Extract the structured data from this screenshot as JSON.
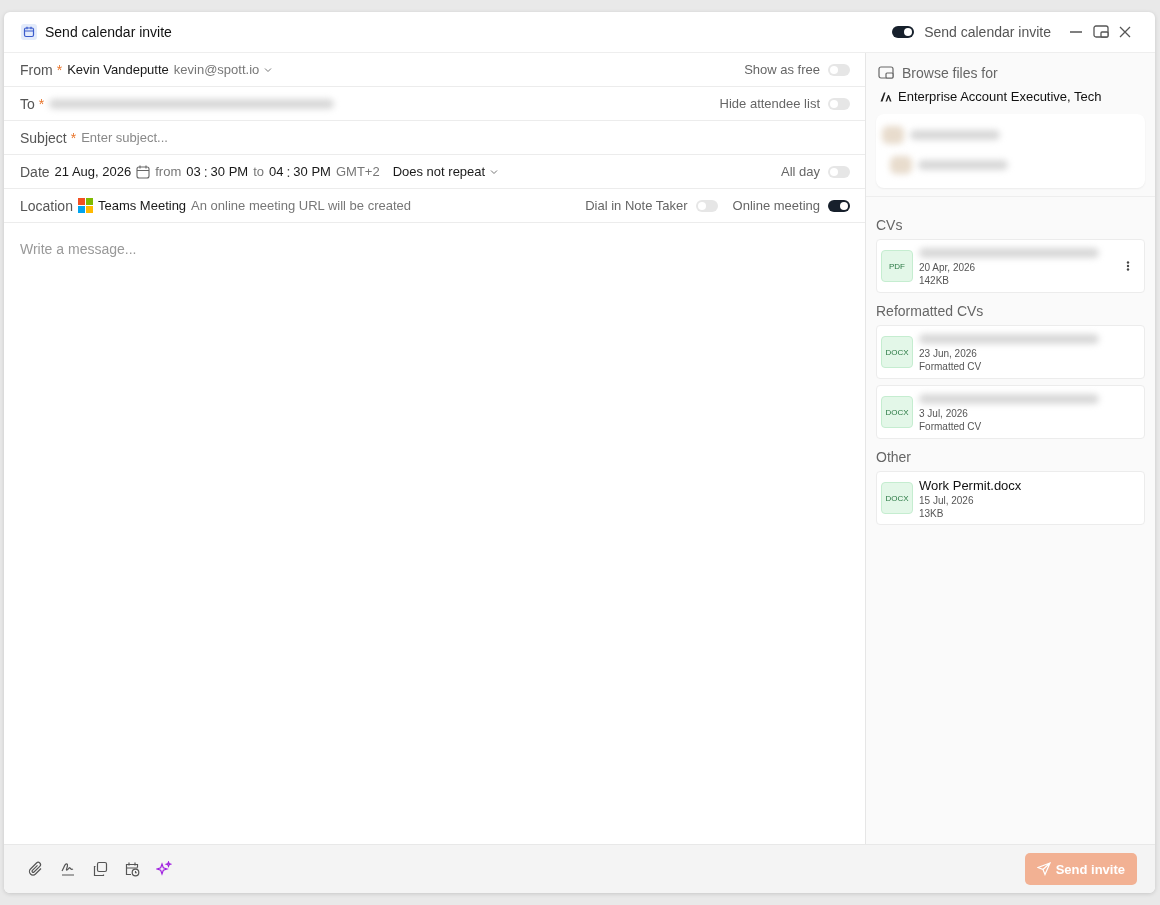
{
  "window": {
    "title": "Send calendar invite",
    "header_toggle": {
      "label": "Send calendar invite",
      "on": true
    }
  },
  "form": {
    "from": {
      "label": "From",
      "required_mark": "*",
      "name": "Kevin Vandeputte",
      "email": "kevin@spott.io",
      "toggle": {
        "label": "Show as free",
        "on": false
      }
    },
    "to": {
      "label": "To",
      "required_mark": "*",
      "toggle": {
        "label": "Hide attendee list",
        "on": false
      }
    },
    "subject": {
      "label": "Subject",
      "required_mark": "*",
      "placeholder": "Enter subject..."
    },
    "date": {
      "label": "Date",
      "date": "21 Aug, 2026",
      "from_word": "from",
      "start_h": "03",
      "start_sep": ":",
      "start_m": "30 PM",
      "to_word": "to",
      "end_h": "04",
      "end_sep": ":",
      "end_m": "30 PM",
      "timezone": "GMT+2",
      "repeat": "Does not repeat",
      "toggle": {
        "label": "All day",
        "on": false
      }
    },
    "location": {
      "label": "Location",
      "service": "Teams Meeting",
      "note": "An online meeting URL will be created",
      "toggles": [
        {
          "label": "Dial in Note Taker",
          "on": false
        },
        {
          "label": "Online meeting",
          "on": true
        }
      ]
    },
    "message": {
      "placeholder": "Write a message..."
    }
  },
  "sidebar": {
    "title": "Browse files for",
    "job": "Enterprise Account Executive, Tech",
    "sections": [
      {
        "title": "CVs",
        "files": [
          {
            "type": "PDF",
            "date": "20 Apr, 2026",
            "meta": "142KB",
            "menu": true
          }
        ]
      },
      {
        "title": "Reformatted CVs",
        "files": [
          {
            "type": "DOCX",
            "date": "23 Jun, 2026",
            "meta": "Formatted CV",
            "menu": false
          },
          {
            "type": "DOCX",
            "date": "3 Jul, 2026",
            "meta": "Formatted CV",
            "menu": false
          }
        ]
      },
      {
        "title": "Other",
        "files": [
          {
            "type": "DOCX",
            "name": "Work Permit.docx",
            "date": "15 Jul, 2026",
            "meta": "13KB",
            "menu": false
          }
        ]
      }
    ]
  },
  "footer": {
    "send_button": "Send invite"
  }
}
